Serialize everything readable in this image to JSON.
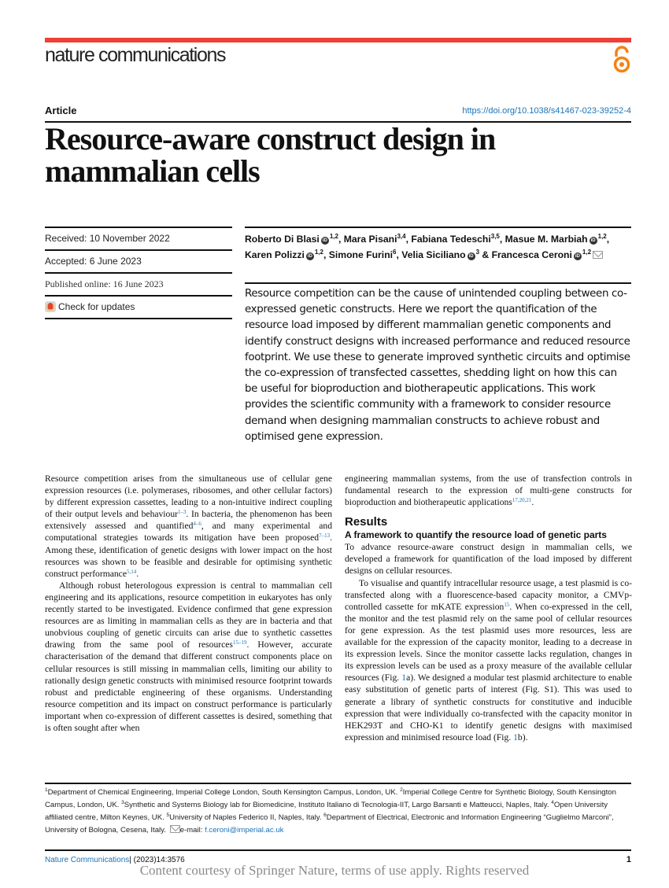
{
  "header": {
    "journal_name": "nature communications",
    "open_access_icon": "open-access-icon",
    "article_type": "Article",
    "doi": "https://doi.org/10.1038/s41467-023-39252-4",
    "accent_color": "#ee4035",
    "link_color": "#1a74b9"
  },
  "title": "Resource-aware construct design in mammalian cells",
  "meta": {
    "received": "Received: 10 November 2022",
    "accepted": "Accepted: 6 June 2023",
    "published": "Published online: 16 June 2023",
    "check_updates": "Check for updates"
  },
  "authors": [
    {
      "name": "Roberto Di Blasi",
      "orcid": true,
      "aff": "1,2",
      "sep": ", "
    },
    {
      "name": "Mara Pisani",
      "orcid": false,
      "aff": "3,4",
      "sep": ", "
    },
    {
      "name": "Fabiana Tedeschi",
      "orcid": false,
      "aff": "3,5",
      "sep": ", "
    },
    {
      "name": "Masue M. Marbiah",
      "orcid": true,
      "aff": "1,2",
      "sep": ", "
    },
    {
      "name": "Karen Polizzi",
      "orcid": true,
      "aff": "1,2",
      "sep": ", "
    },
    {
      "name": "Simone Furini",
      "orcid": false,
      "aff": "6",
      "sep": ", "
    },
    {
      "name": "Velia Siciliano",
      "orcid": true,
      "aff": "3",
      "sep": " & "
    },
    {
      "name": "Francesca Ceroni",
      "orcid": true,
      "aff": "1,2",
      "sep": "",
      "corresponding": true
    }
  ],
  "abstract": "Resource competition can be the cause of unintended coupling between co-expressed genetic constructs. Here we report the quantification of the resource load imposed by different mammalian genetic components and identify construct designs with increased performance and reduced resource footprint. We use these to generate improved synthetic circuits and optimise the co-expression of transfected cassettes, shedding light on how this can be useful for bioproduction and biotherapeutic applications. This work provides the scientific community with a framework to consider resource demand when designing mammalian constructs to achieve robust and optimised gene expression.",
  "body": {
    "p1": [
      {
        "t": "Resource competition arises from the simultaneous use of cellular gene expression resources (i.e. polymerases, ribosomes, and other cellular factors) by different expression cassettes, leading to a non-intuitive indirect coupling of their output levels and behaviour"
      },
      {
        "r": "1–3"
      },
      {
        "t": ". In bacteria, the phenomenon has been extensively assessed and quantified"
      },
      {
        "r": "4–6"
      },
      {
        "t": ", and many experimental and computational strategies towards its mitigation have been proposed"
      },
      {
        "r": "7–13"
      },
      {
        "t": ". Among these, identification of genetic designs with lower impact on the host resources was shown to be feasible and desirable for optimising synthetic construct performance"
      },
      {
        "r": "5,14"
      },
      {
        "t": "."
      }
    ],
    "p2": [
      {
        "t": "Although robust heterologous expression is central to mammalian cell engineering and its applications, resource competition in eukaryotes has only recently started to be investigated. Evidence confirmed that gene expression resources are as limiting in mammalian cells as they are in bacteria and that unobvious coupling of genetic circuits can arise due to synthetic cassettes drawing from the same pool of resources"
      },
      {
        "r": "15–19"
      },
      {
        "t": ". However, accurate characterisation of the demand that different construct components place on cellular resources is still missing in mammalian cells, limiting our ability to rationally design genetic constructs with minimised resource footprint towards robust and predictable engineering of these organisms. Understanding resource competition and its impact on construct performance is particularly important when co-expression of different cassettes is desired, something that is often sought after when engineering mammalian systems, from the use of transfection controls in fundamental research to the expression of multi-gene constructs for bioproduction and biotherapeutic applications"
      },
      {
        "r": "17,20,21"
      },
      {
        "t": "."
      }
    ],
    "p2_right_start": "engineering mammalian systems, from the use of transfection controls in fundamental research to the expression of multi-gene constructs for bioproduction and biotherapeutic applications",
    "results_heading": "Results",
    "subheading": "A framework to quantify the resource load of genetic parts",
    "p3": "To advance resource-aware construct design in mammalian cells, we developed a framework for quantification of the load imposed by different designs on cellular resources.",
    "p4": [
      {
        "t": "To visualise and quantify intracellular resource usage, a test plasmid is co-transfected along with a fluorescence-based capacity monitor, a CMVp-controlled cassette for mKATE expression"
      },
      {
        "r": "15"
      },
      {
        "t": ". When co-expressed in the cell, the monitor and the test plasmid rely on the same pool of cellular resources for gene expression. As the test plasmid uses more resources, less are available for the expression of the capacity monitor, leading to a decrease in its expression levels. Since the monitor cassette lacks regulation, changes in its expression levels can be used as a proxy measure of the available cellular resources (Fig. "
      },
      {
        "f": "1"
      },
      {
        "t": "a). We designed a modular test plasmid architecture to enable easy substitution of genetic parts of interest (Fig. S1). This was used to generate a library of synthetic constructs for constitutive and inducible expression that were individually co-transfected with the capacity monitor in HEK293T and CHO-K1 to identify genetic designs with maximised expression and minimised resource load (Fig. "
      },
      {
        "f": "1"
      },
      {
        "t": "b)."
      }
    ]
  },
  "affiliations": [
    {
      "n": "1",
      "text": "Department of Chemical Engineering, Imperial College London, South Kensington Campus, London, UK. "
    },
    {
      "n": "2",
      "text": "Imperial College Centre for Synthetic Biology, South Kensington Campus, London, UK. "
    },
    {
      "n": "3",
      "text": "Synthetic and Systems Biology lab for Biomedicine, Instituto Italiano di Tecnologia-IIT, Largo Barsanti e Matteucci, Naples, Italy. "
    },
    {
      "n": "4",
      "text": "Open University affiliated centre, Milton Keynes, UK. "
    },
    {
      "n": "5",
      "text": "University of Naples Federico II, Naples, Italy. "
    },
    {
      "n": "6",
      "text": "Department of Electrical, Electronic and Information Engineering “Guglielmo Marconi”, University of Bologna, Cesena, Italy. "
    }
  ],
  "email_label": "e-mail: ",
  "email": "f.ceroni@imperial.ac.uk",
  "footer": {
    "journal": "Nature Communications",
    "citation": "| (2023)14:3576",
    "page_number": "1",
    "watermark": "Content courtesy of Springer Nature, terms of use apply. Rights reserved"
  }
}
